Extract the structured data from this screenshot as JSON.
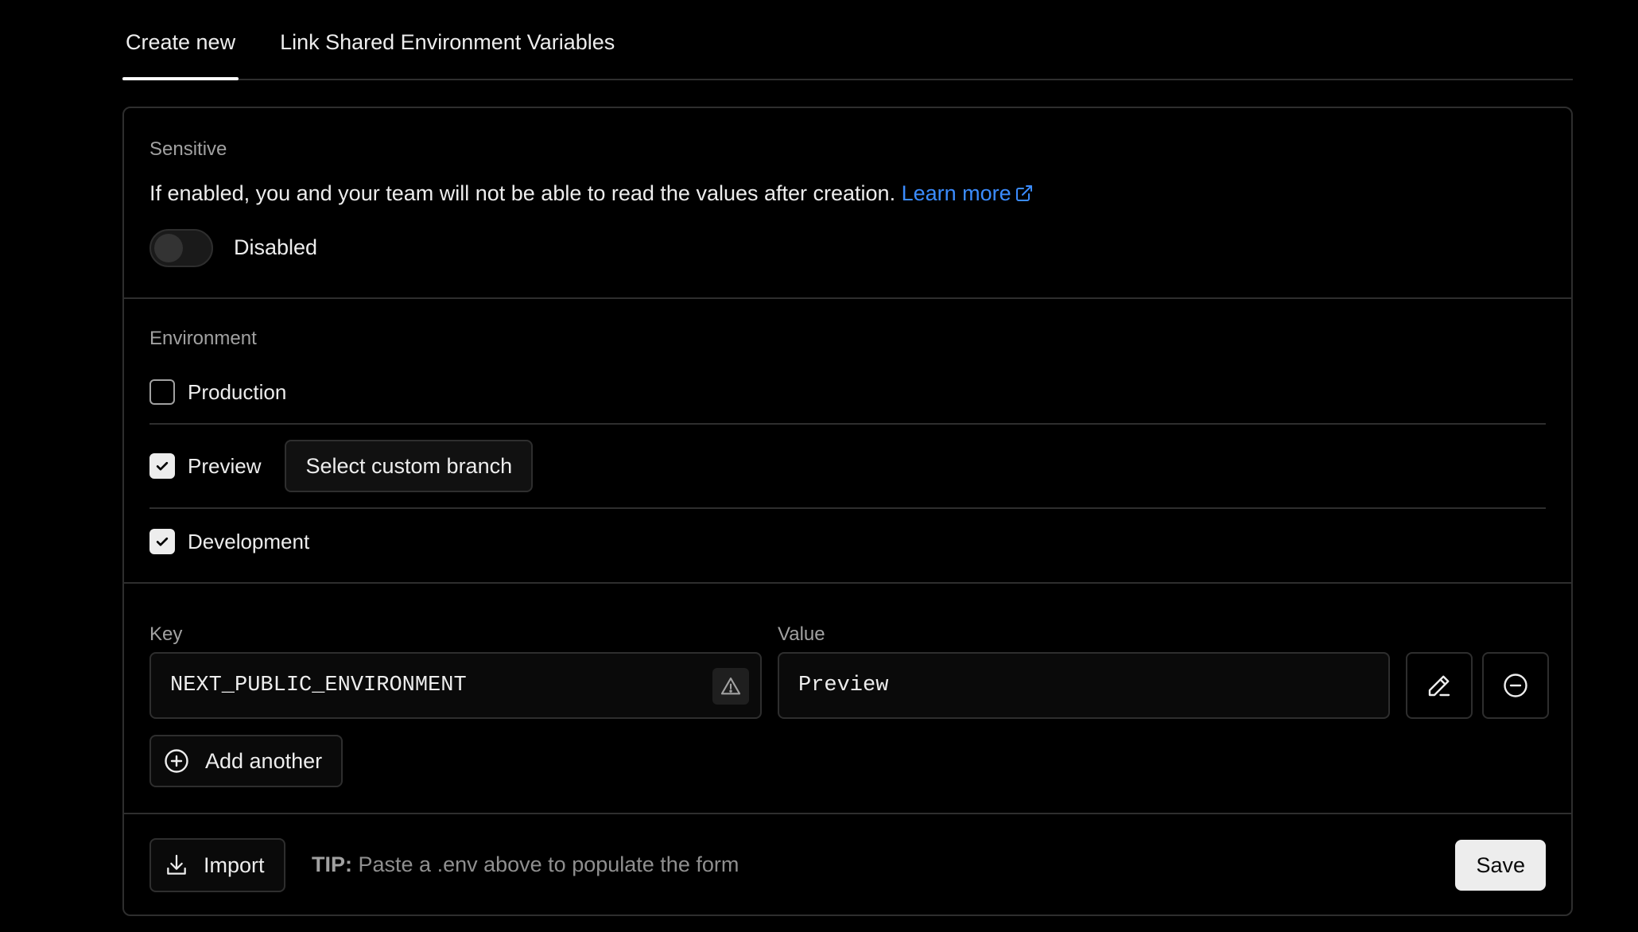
{
  "tabs": [
    {
      "label": "Create new",
      "active": true
    },
    {
      "label": "Link Shared Environment Variables",
      "active": false
    }
  ],
  "sensitive": {
    "title": "Sensitive",
    "description": "If enabled, you and your team will not be able to read the values after creation.",
    "link_label": "Learn more",
    "link_icon": "external-link-icon",
    "toggle_state": "Disabled",
    "enabled": false
  },
  "environment": {
    "title": "Environment",
    "options": [
      {
        "label": "Production",
        "checked": false
      },
      {
        "label": "Preview",
        "checked": true
      },
      {
        "label": "Development",
        "checked": true
      }
    ],
    "custom_branch_button": "Select custom branch"
  },
  "kv": {
    "key_label": "Key",
    "value_label": "Value",
    "key_value": "NEXT_PUBLIC_ENVIRONMENT",
    "value_value": "Preview",
    "warning_icon": "warning-triangle-icon",
    "edit_icon": "pencil-icon",
    "remove_icon": "minus-circle-icon",
    "add_another": "Add another",
    "add_icon": "plus-circle-icon"
  },
  "footer": {
    "import_label": "Import",
    "import_icon": "download-icon",
    "tip_label": "TIP:",
    "tip_text": "Paste a .env above to populate the form",
    "save_label": "Save"
  },
  "colors": {
    "background": "#000000",
    "border": "#2e2e2e",
    "link": "#3b8cff",
    "text": "#ededed",
    "muted": "#a1a1a1"
  }
}
